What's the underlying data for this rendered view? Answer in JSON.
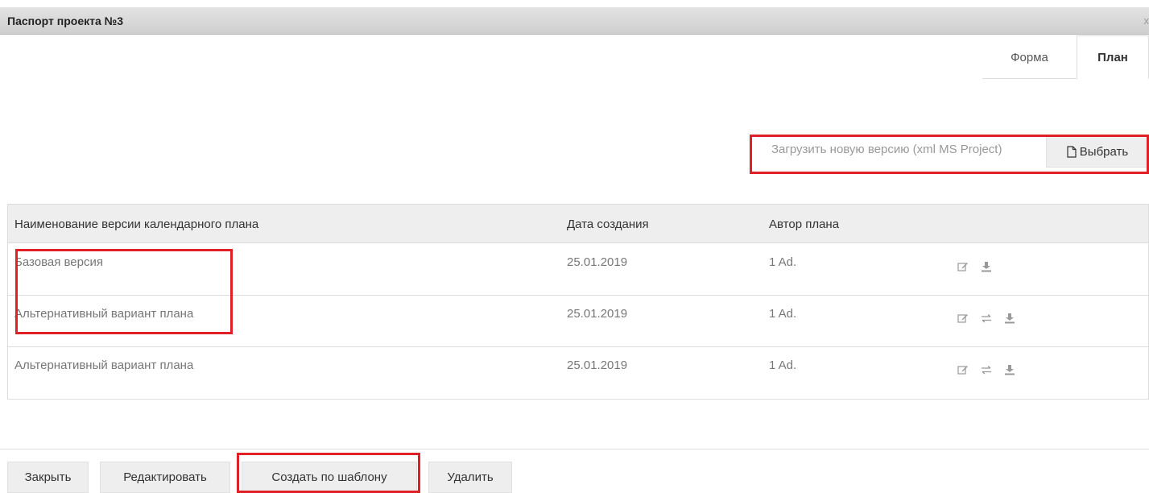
{
  "window": {
    "title": "Паспорт проекта №3",
    "close_glyph": "x"
  },
  "tabs": [
    {
      "label": "Форма",
      "active": false
    },
    {
      "label": "План",
      "active": true
    }
  ],
  "upload": {
    "label": "Загрузить новую версию (xml MS Project)",
    "button_label": "Выбрать",
    "button_icon": "file-icon"
  },
  "table": {
    "headers": [
      "Наименование версии календарного плана",
      "Дата создания",
      "Автор плана",
      ""
    ],
    "rows": [
      {
        "name": "Базовая версия",
        "date": "25.01.2019",
        "author": "1 Ad.",
        "actions": [
          "edit-icon",
          "download-icon"
        ]
      },
      {
        "name": "Альтернативный вариант плана",
        "date": "25.01.2019",
        "author": "1 Ad.",
        "actions": [
          "edit-icon",
          "swap-icon",
          "download-icon"
        ]
      },
      {
        "name": "Альтернативный вариант плана",
        "date": "25.01.2019",
        "author": "1 Ad.",
        "actions": [
          "edit-icon",
          "swap-icon",
          "download-icon"
        ]
      }
    ]
  },
  "footer": {
    "buttons": [
      "Закрыть",
      "Редактировать",
      "Создать по шаблону",
      "Удалить"
    ]
  },
  "colors": {
    "highlight": "#e01f26",
    "header_bg": "#eeeeee",
    "button_bg": "#eeeeee"
  }
}
